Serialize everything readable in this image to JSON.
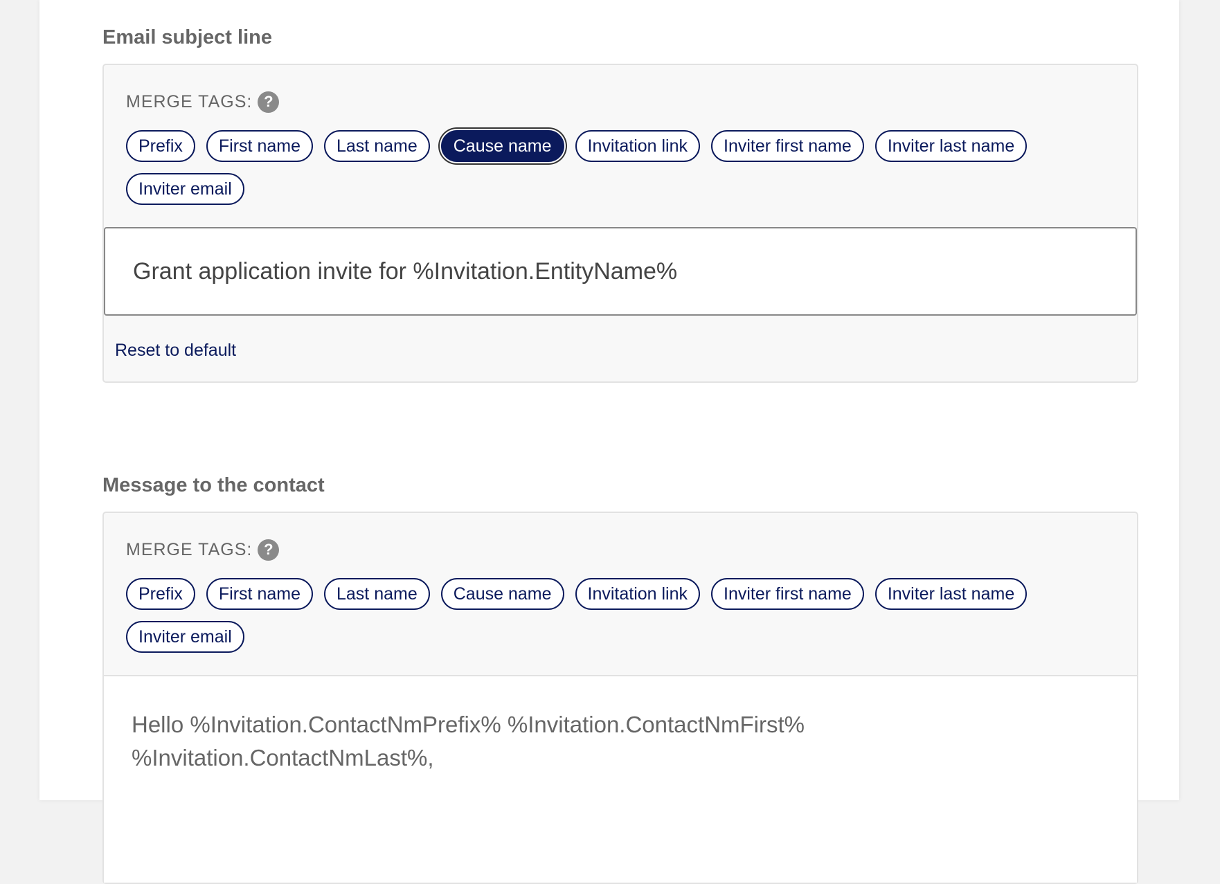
{
  "subject_section": {
    "label": "Email subject line",
    "merge_label": "MERGE TAGS:",
    "help_glyph": "?",
    "tags": [
      "Prefix",
      "First name",
      "Last name",
      "Cause name",
      "Invitation link",
      "Inviter first name",
      "Inviter last name",
      "Inviter email"
    ],
    "active_tag": "Cause name",
    "subject_value": "Grant application invite for %Invitation.EntityName%",
    "reset_label": "Reset to default"
  },
  "message_section": {
    "label": "Message to the contact",
    "merge_label": "MERGE TAGS:",
    "help_glyph": "?",
    "tags": [
      "Prefix",
      "First name",
      "Last name",
      "Cause name",
      "Invitation link",
      "Inviter first name",
      "Inviter last name",
      "Inviter email"
    ],
    "body_line1": "Hello %Invitation.ContactNmPrefix% %Invitation.ContactNmFirst%",
    "body_line2": "%Invitation.ContactNmLast%,"
  },
  "colors": {
    "accent": "#0b1a5c",
    "help_icon": "#8a8a8a",
    "box_bg": "#f8f8f8"
  }
}
